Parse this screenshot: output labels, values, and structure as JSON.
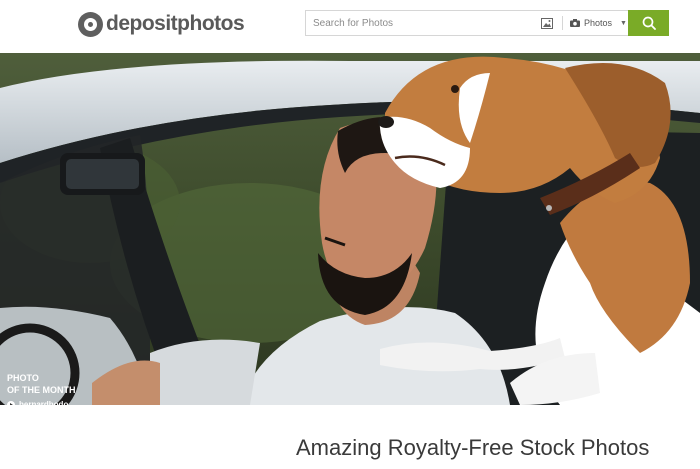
{
  "brand": {
    "name": "depositphotos"
  },
  "search": {
    "placeholder": "Search for Photos",
    "value": "",
    "type_label": "Photos",
    "image_search_icon": "image-icon",
    "camera_icon": "camera-icon",
    "submit_icon": "search-icon"
  },
  "hero": {
    "caption_line1": "PHOTO",
    "caption_line2": "OF THE MONTH",
    "author": "bernardbodo"
  },
  "main": {
    "headline": "Amazing Royalty-Free Stock Photos"
  },
  "colors": {
    "accent": "#7aab27",
    "logo": "#5a5a5a",
    "headline": "#3a3a3a"
  }
}
